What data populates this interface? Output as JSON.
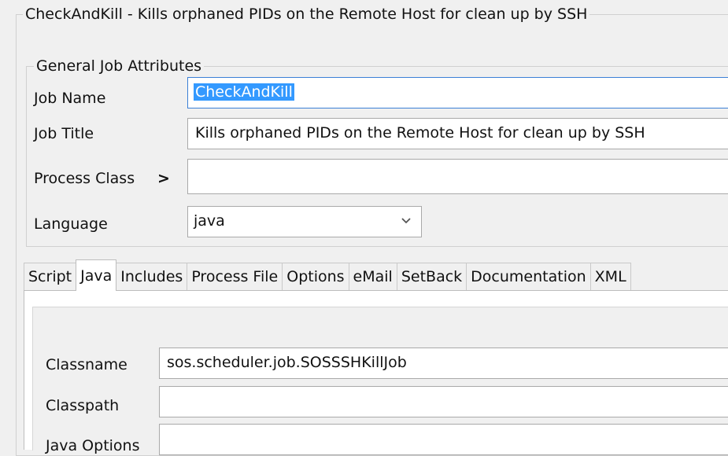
{
  "window": {
    "group_title": "CheckAndKill - Kills orphaned PIDs on the Remote Host for clean up by SSH"
  },
  "general": {
    "title": "General Job Attributes",
    "job_name_label": "Job Name",
    "job_name_value": "CheckAndKill",
    "job_title_label": "Job Title",
    "job_title_value": "Kills orphaned PIDs on the Remote Host for clean up by SSH",
    "process_class_label": "Process Class",
    "process_class_arrow": ">",
    "process_class_value": "",
    "language_label": "Language",
    "language_value": "java"
  },
  "tabs": [
    {
      "label": "Script",
      "active": false
    },
    {
      "label": "Java",
      "active": true
    },
    {
      "label": "Includes",
      "active": false
    },
    {
      "label": "Process File",
      "active": false
    },
    {
      "label": "Options",
      "active": false
    },
    {
      "label": "eMail",
      "active": false
    },
    {
      "label": "SetBack",
      "active": false
    },
    {
      "label": "Documentation",
      "active": false
    },
    {
      "label": "XML",
      "active": false
    }
  ],
  "java": {
    "classname_label": "Classname",
    "classname_value": "sos.scheduler.job.SOSSSHKillJob",
    "classpath_label": "Classpath",
    "classpath_value": "",
    "java_options_label": "Java Options",
    "java_options_value": ""
  },
  "icons": {
    "dropdown": "chevron-down-icon",
    "process_class_more": "chevron-right-icon"
  }
}
